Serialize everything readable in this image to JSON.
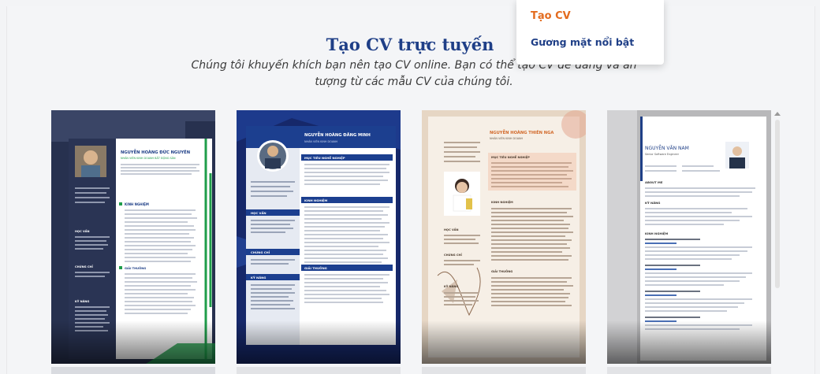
{
  "menu": {
    "create_cv": "Tạo CV",
    "featured_faces": "Gương mặt nổi bật"
  },
  "section": {
    "title": "Tạo CV trực tuyến",
    "subtitle": "Chúng tôi khuyến khích bạn nên tạo CV online. Bạn có thể tạo CV dễ dàng và ấn tượng từ các mẫu CV của chúng tôi."
  },
  "templates": [
    {
      "name": "NGUYỄN HOÀNG ĐỨC NGUYÊN",
      "role": "NHÂN VIÊN KINH DOANH BẤT ĐỘNG SẢN",
      "headings": [
        "KINH NGHIỆM",
        "HỌC VẤN",
        "CHỨNG CHỈ",
        "KỸ NĂNG",
        "GIẢI THƯỞNG"
      ],
      "accent": "#1f9d4a"
    },
    {
      "name": "NGUYỄN HOÀNG ĐĂNG MINH",
      "role": "NHÂN VIÊN KINH DOANH",
      "headings": [
        "MỤC TIÊU NGHỀ NGHIỆP",
        "KINH NGHIỆM",
        "HỌC VẤN",
        "CHỨNG CHỈ",
        "KỸ NĂNG",
        "GIẢI THƯỞNG"
      ],
      "accent": "#1c3f8f"
    },
    {
      "name": "NGUYỄN HOÀNG THIÊN NGA",
      "role": "NHÂN VIÊN KINH DOANH",
      "headings": [
        "MỤC TIÊU NGHỀ NGHIỆP",
        "KINH NGHIỆM",
        "HỌC VẤN",
        "CHỨNG CHỈ",
        "KỸ NĂNG",
        "GIẢI THƯỞNG"
      ],
      "accent": "#d2692a"
    },
    {
      "name": "NGUYỄN VĂN NAM",
      "role": "Senior Software Engineer",
      "headings": [
        "ABOUT ME",
        "KỸ NĂNG",
        "KINH NGHIỆM"
      ],
      "accent": "#1f3f87"
    }
  ],
  "icons": [
    "scroll-up-icon"
  ]
}
